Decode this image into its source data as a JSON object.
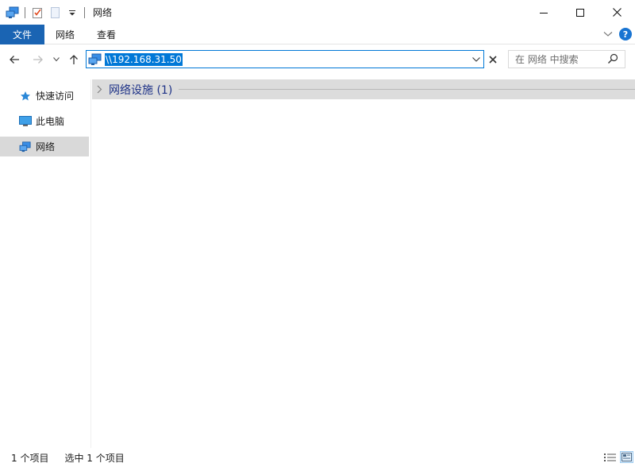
{
  "window": {
    "title": "网络",
    "controls": {
      "minimize": "—",
      "maximize": "☐",
      "close": "✕"
    }
  },
  "ribbon": {
    "tabs": [
      "文件",
      "网络",
      "查看"
    ]
  },
  "navigation": {
    "address": "\\\\192.168.31.50",
    "search_placeholder": "在 网络 中搜索"
  },
  "sidebar": {
    "items": [
      {
        "label": "快速访问",
        "icon": "star-icon"
      },
      {
        "label": "此电脑",
        "icon": "computer-icon"
      },
      {
        "label": "网络",
        "icon": "network-icon",
        "selected": true
      }
    ]
  },
  "content": {
    "group_title": "网络设施 (1)"
  },
  "status": {
    "item_count": "1 个项目",
    "selected_count": "选中 1 个项目"
  },
  "colors": {
    "accent": "#0078d7",
    "file_tab": "#1a64b3",
    "group_title": "#1e3287",
    "selected_bg": "#d9d9d9"
  }
}
